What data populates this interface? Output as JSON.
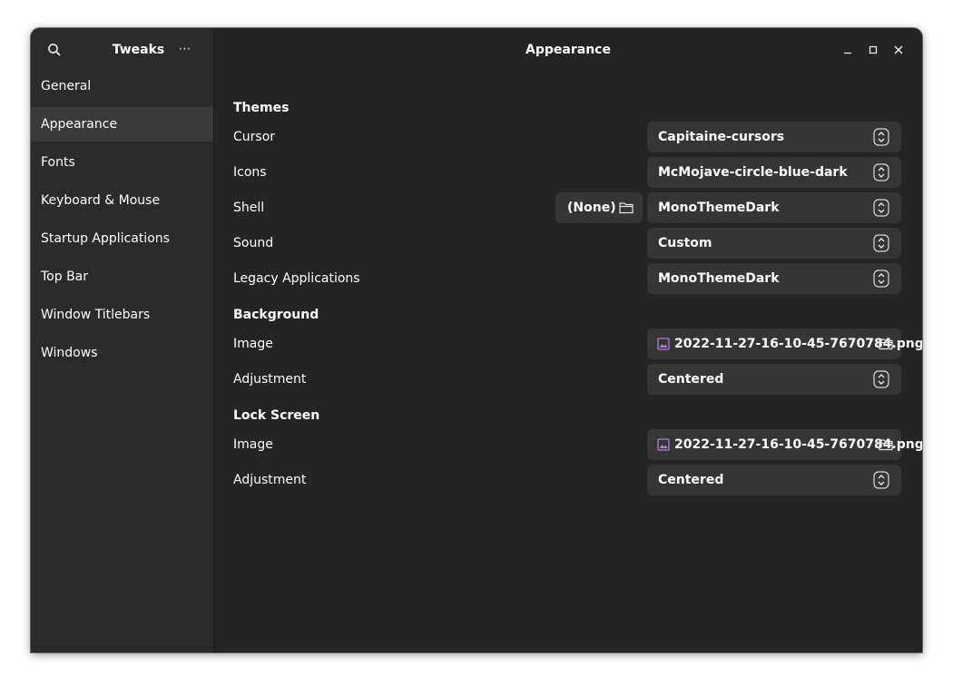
{
  "sidebar": {
    "title": "Tweaks",
    "menu_label": "⋯",
    "items": [
      {
        "label": "General"
      },
      {
        "label": "Appearance"
      },
      {
        "label": "Fonts"
      },
      {
        "label": "Keyboard & Mouse"
      },
      {
        "label": "Startup Applications"
      },
      {
        "label": "Top Bar"
      },
      {
        "label": "Window Titlebars"
      },
      {
        "label": "Windows"
      }
    ],
    "active_index": 1
  },
  "header": {
    "title": "Appearance"
  },
  "themes": {
    "heading": "Themes",
    "cursor": {
      "label": "Cursor",
      "value": "Capitaine-cursors"
    },
    "icons": {
      "label": "Icons",
      "value": "McMojave-circle-blue-dark"
    },
    "shell": {
      "label": "Shell",
      "none_label": "(None)",
      "value": "MonoThemeDark"
    },
    "sound": {
      "label": "Sound",
      "value": "Custom"
    },
    "legacy": {
      "label": "Legacy Applications",
      "value": "MonoThemeDark"
    }
  },
  "background": {
    "heading": "Background",
    "image": {
      "label": "Image",
      "value": "2022-11-27-16-10-45-7670784.png"
    },
    "adjustment": {
      "label": "Adjustment",
      "value": "Centered"
    }
  },
  "lock_screen": {
    "heading": "Lock Screen",
    "image": {
      "label": "Image",
      "value": "2022-11-27-16-10-45-7670784.png"
    },
    "adjustment": {
      "label": "Adjustment",
      "value": "Centered"
    }
  },
  "icons": {
    "search": "search-icon",
    "menu": "more-icon",
    "minimize": "minimize-icon",
    "maximize": "maximize-icon",
    "close": "close-icon",
    "spin": "up-down-arrows-icon",
    "folder": "folder-icon",
    "image": "image-icon"
  },
  "colors": {
    "window_bg": "#242424",
    "sidebar_bg": "#2b2b2b",
    "active_item_bg": "#3a3a3a",
    "control_bg": "#353535",
    "image_icon_accent": "#b57ad9"
  }
}
